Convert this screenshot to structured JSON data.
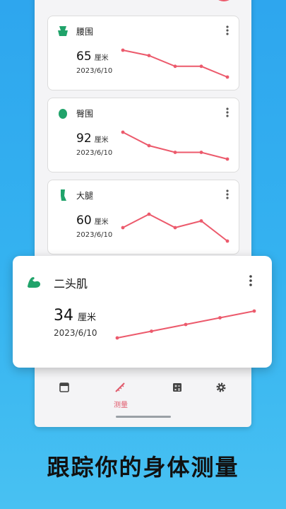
{
  "cards": [
    {
      "title": "腰围",
      "value": "65",
      "unit": "厘米",
      "date": "2023/6/10",
      "trend": [
        68,
        67,
        65,
        65,
        63
      ]
    },
    {
      "title": "臀围",
      "value": "92",
      "unit": "厘米",
      "date": "2023/6/10",
      "trend": [
        95,
        93,
        92,
        92,
        91
      ]
    },
    {
      "title": "大腿",
      "value": "60",
      "unit": "厘米",
      "date": "2023/6/10",
      "trend": [
        59,
        61,
        59,
        60,
        57
      ]
    }
  ],
  "featured": {
    "title": "二头肌",
    "value": "34",
    "unit": "厘米",
    "date": "2023/6/10",
    "trend": [
      30,
      31,
      32,
      33,
      34
    ]
  },
  "nav": {
    "measure_label": "测量"
  },
  "fab_label": "+",
  "slogan": "跟踪你的身体测量",
  "colors": {
    "accent": "#ec5a6c",
    "icon_green": "#20a36a",
    "background": "#2ea6ee"
  }
}
